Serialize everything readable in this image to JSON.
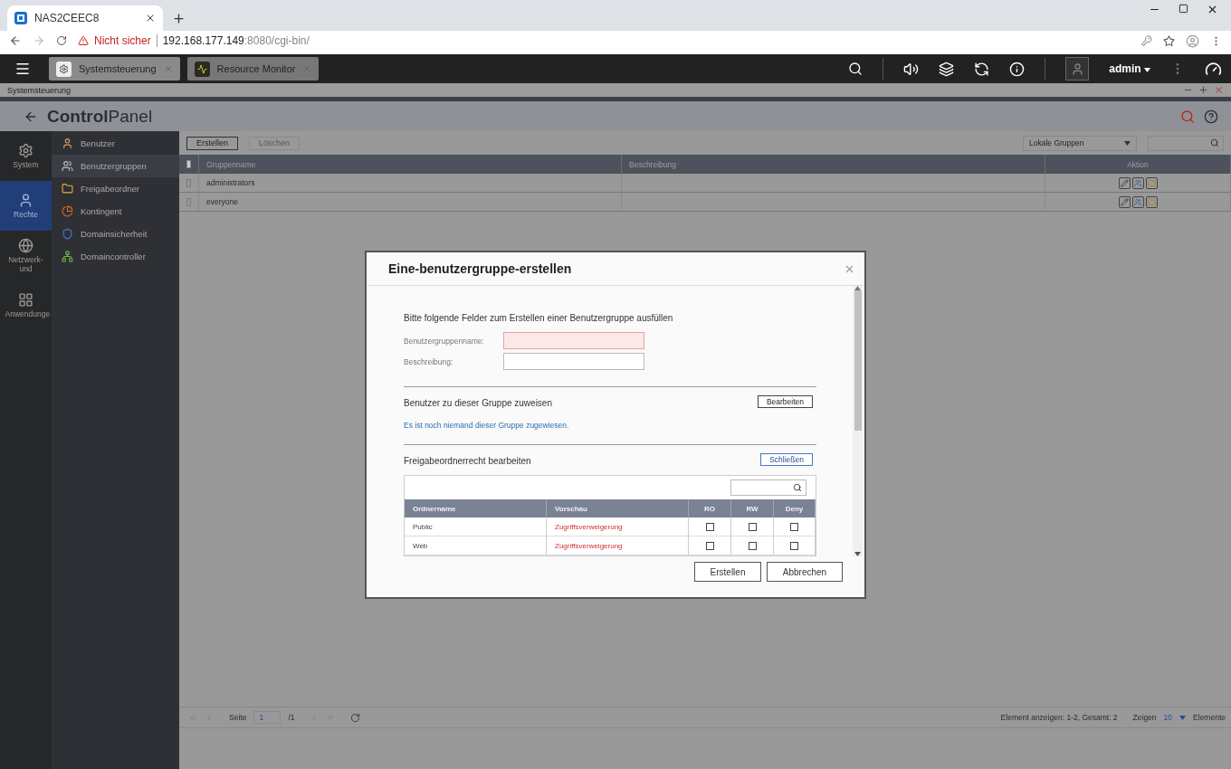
{
  "browser": {
    "tab_title": "NAS2CEEC8",
    "security": "Nicht sicher",
    "url_host": "192.168.177.149",
    "url_rest": ":8080/cgi-bin/"
  },
  "topbar": {
    "apps": [
      {
        "label": "Systemsteuerung",
        "selected": true,
        "kind": "gear"
      },
      {
        "label": "Resource Monitor",
        "selected": false,
        "kind": "monitor"
      }
    ],
    "user": "admin"
  },
  "window_title": "Systemsteuerung",
  "header": {
    "title_bold": "Control",
    "title_light": "Panel"
  },
  "rail": [
    {
      "label": "System",
      "selected": false,
      "kind": "gear"
    },
    {
      "label": "Rechte",
      "selected": true,
      "kind": "user"
    },
    {
      "label": "Netzwerk- und",
      "selected": false,
      "kind": "globe"
    },
    {
      "label": "Anwendunge",
      "selected": false,
      "kind": "apps"
    }
  ],
  "menu": [
    {
      "label": "Benutzer",
      "selected": false,
      "kind": "user"
    },
    {
      "label": "Benutzergruppen",
      "selected": true,
      "kind": "group"
    },
    {
      "label": "Freigabeordner",
      "selected": false,
      "kind": "folder"
    },
    {
      "label": "Kontingent",
      "selected": false,
      "kind": "quota"
    },
    {
      "label": "Domainsicherheit",
      "selected": false,
      "kind": "domain"
    },
    {
      "label": "Domaincontroller",
      "selected": false,
      "kind": "controller"
    }
  ],
  "toolbar": {
    "buttons": [
      {
        "label": "Erstellen",
        "disabled": false
      },
      {
        "label": "Löschen",
        "disabled": true
      }
    ],
    "filter": "Lokale Gruppen"
  },
  "table": {
    "select_all_checked": false,
    "columns": [
      "Gruppenname",
      "Beschreibung",
      "Aktion"
    ],
    "rows": [
      {
        "name": "administrators",
        "checked": false
      },
      {
        "name": "everyone",
        "checked": false
      }
    ]
  },
  "pager": {
    "page_label": "Seite",
    "page": "1",
    "total": "/1",
    "summary": "Element anzeigen: 1-2, Gesamt: 2",
    "show_label": "Zeigen",
    "per_page": "10",
    "items_label": "Elemente"
  },
  "dialog": {
    "title": "Eine-benutzergruppe-erstellen",
    "intro": "Bitte folgende Felder zum Erstellen einer Benutzergruppe ausfüllen",
    "fields": [
      {
        "label": "Benutzergruppenname:",
        "invalid": true
      },
      {
        "label": "Beschreibung:",
        "invalid": false
      }
    ],
    "assign_heading": "Benutzer zu dieser Gruppe zuweisen",
    "edit_button": "Bearbeiten",
    "empty_note": "Es ist noch niemand dieser Gruppe zugewiesen.",
    "share_heading": "Freigabeordnerrecht bearbeiten",
    "close_button": "Schließen",
    "folder_columns": [
      "Ordnername",
      "Vorschau",
      "RO",
      "RW",
      "Deny"
    ],
    "folders": [
      {
        "name": "Public",
        "preview": "Zugriffsverweigerung",
        "ro": false,
        "rw": false,
        "deny": false
      },
      {
        "name": "Web",
        "preview": "Zugriffsverweigerung",
        "ro": false,
        "rw": false,
        "deny": false
      }
    ],
    "buttons": [
      "Erstellen",
      "Abbrechen"
    ]
  }
}
